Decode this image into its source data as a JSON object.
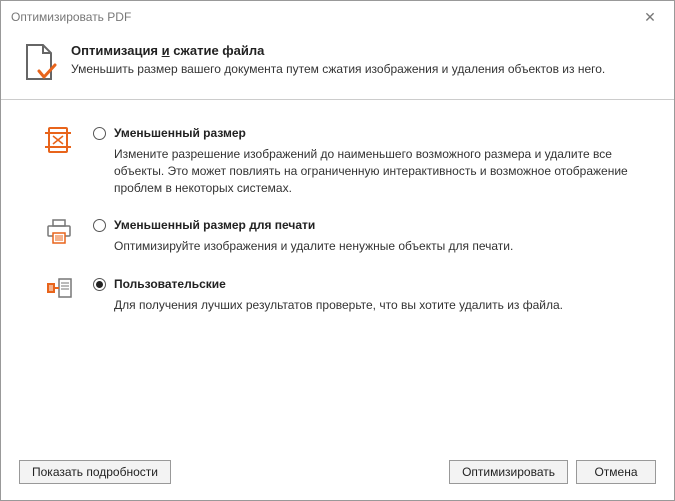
{
  "titlebar": {
    "title": "Оптимизировать PDF"
  },
  "header": {
    "title_pre": "Оптимизация ",
    "title_ul": "и",
    "title_post": " сжатие файла",
    "subtitle": "Уменьшить размер вашего документа путем сжатия изображения и удаления объектов из него."
  },
  "options": {
    "reduced": {
      "label": "Уменьшенный размер",
      "desc": "Измените разрешение изображений до наименьшего возможного размера и удалите все объекты. Это может повлиять на ограниченную интерактивность и возможное отображение проблем в некоторых системах."
    },
    "print": {
      "label": "Уменьшенный размер для печати",
      "desc": "Оптимизируйте изображения и удалите ненужные объекты для печати."
    },
    "custom": {
      "label": "Пользовательские",
      "desc": "Для получения лучших результатов проверьте, что вы хотите удалить из файла."
    }
  },
  "footer": {
    "details": "Показать подробности",
    "optimize": "Оптимизировать",
    "cancel": "Отмена"
  }
}
